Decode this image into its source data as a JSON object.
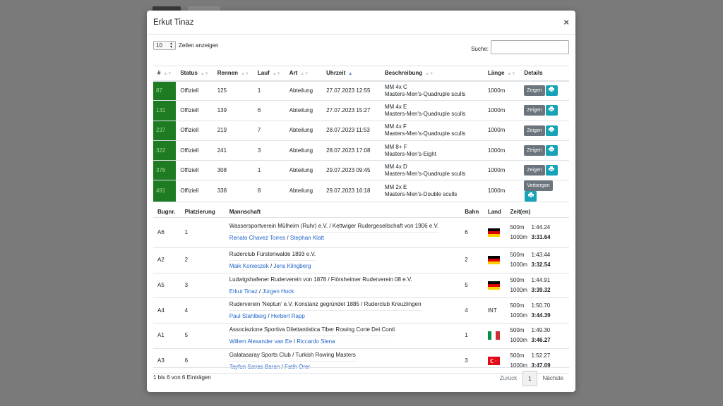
{
  "modal": {
    "title": "Erkut Tinaz"
  },
  "controls": {
    "length_value": "10",
    "length_label": "Zeilen anzeigen",
    "search_label": "Suche:"
  },
  "main_table": {
    "headers": [
      "#",
      "Status",
      "Rennen",
      "Lauf",
      "Art",
      "Uhrzeit",
      "Beschreibung",
      "Länge",
      "Details"
    ],
    "rows": [
      {
        "num": "87",
        "status": "Offiziell",
        "rennen": "125",
        "lauf": "1",
        "art": "Abteilung",
        "uhrzeit": "27.07.2023 12:55",
        "desc1": "MM 4x C",
        "desc2": "Masters-Men's-Quadruple sculls",
        "laenge": "1000m",
        "button": "Zeigen"
      },
      {
        "num": "131",
        "status": "Offiziell",
        "rennen": "139",
        "lauf": "6",
        "art": "Abteilung",
        "uhrzeit": "27.07.2023 15:27",
        "desc1": "MM 4x E",
        "desc2": "Masters-Men's-Quadruple sculls",
        "laenge": "1000m",
        "button": "Zeigen"
      },
      {
        "num": "237",
        "status": "Offiziell",
        "rennen": "219",
        "lauf": "7",
        "art": "Abteilung",
        "uhrzeit": "28.07.2023 11:53",
        "desc1": "MM 4x F",
        "desc2": "Masters-Men's-Quadruple sculls",
        "laenge": "1000m",
        "button": "Zeigen"
      },
      {
        "num": "322",
        "status": "Offiziell",
        "rennen": "241",
        "lauf": "3",
        "art": "Abteilung",
        "uhrzeit": "28.07.2023 17:08",
        "desc1": "MM 8+ F",
        "desc2": "Masters-Men's-Eight",
        "laenge": "1000m",
        "button": "Zeigen"
      },
      {
        "num": "376",
        "status": "Offiziell",
        "rennen": "308",
        "lauf": "1",
        "art": "Abteilung",
        "uhrzeit": "29.07.2023 09:45",
        "desc1": "MM 4x D",
        "desc2": "Masters-Men's-Quadruple sculls",
        "laenge": "1000m",
        "button": "Zeigen"
      },
      {
        "num": "491",
        "status": "Offiziell",
        "rennen": "338",
        "lauf": "8",
        "art": "Abteilung",
        "uhrzeit": "29.07.2023 16:18",
        "desc1": "MM 2x E",
        "desc2": "Masters-Men's-Double sculls",
        "laenge": "1000m",
        "button": "Verbergen"
      }
    ],
    "highlight_color": "#1e7b22"
  },
  "detail_table": {
    "headers": [
      "Bugnr.",
      "Platzierung",
      "Mannschaft",
      "Bahn",
      "Land",
      "Zeit(en)"
    ],
    "rows": [
      {
        "bug": "A6",
        "platz": "1",
        "team": "Wassersportverein Mülheim (Ruhr) e.V. / Kettwiger Rudergesellschaft von 1906 e.V.",
        "rower1": "Renato Chavez Torres",
        "rower2": "Stephan Klatt",
        "bahn": "6",
        "land": "",
        "flag": "germany",
        "d1": "500m",
        "t1": "1:44.24",
        "d2": "1000m",
        "t2": "3:31.64"
      },
      {
        "bug": "A2",
        "platz": "2",
        "team": "Ruderclub Fürstenwalde 1893 e.V.",
        "rower1": "Maik Konieczek",
        "rower2": "Jens Klingberg",
        "bahn": "2",
        "land": "",
        "flag": "germany",
        "d1": "500m",
        "t1": "1:43.44",
        "d2": "1000m",
        "t2": "3:32.54"
      },
      {
        "bug": "A5",
        "platz": "3",
        "team": "Ludwigshafener Ruderverein von 1878 / Flörsheimer Ruderverein 08 e.V.",
        "rower1": "Erkut Tinaz",
        "rower2": "Jürgen Hock",
        "bahn": "5",
        "land": "",
        "flag": "germany",
        "d1": "500m",
        "t1": "1:44.91",
        "d2": "1000m",
        "t2": "3:39.32"
      },
      {
        "bug": "A4",
        "platz": "4",
        "team": "Ruderverein 'Neptun' e.V. Konstanz gegründet 1885 / Ruderclub Kreuzlingen",
        "rower1": "Paul Stahlberg",
        "rower2": "Herbert Rapp",
        "bahn": "4",
        "land": "INT",
        "flag": "",
        "d1": "500m",
        "t1": "1:50.70",
        "d2": "1000m",
        "t2": "3:44.39"
      },
      {
        "bug": "A1",
        "platz": "5",
        "team": "Associazione Sportiva Dilettantistica Tiber Rowing Corte Dei Conti",
        "rower1": "Willem Alexander van Ee",
        "rower2": "Riccardo Siena",
        "bahn": "1",
        "land": "",
        "flag": "italy",
        "d1": "500m",
        "t1": "1:49.30",
        "d2": "1000m",
        "t2": "3:46.27"
      },
      {
        "bug": "A3",
        "platz": "6",
        "team": "Galatasaray Sports Club / Turkish Rowing Masters",
        "rower1": "Tayfun Savas Baran",
        "rower2": "Fatih Örer",
        "bahn": "3",
        "land": "",
        "flag": "turkey",
        "d1": "500m",
        "t1": "1:52.27",
        "d2": "1000m",
        "t2": "3:47.09"
      }
    ]
  },
  "footer": {
    "info": "1 bis 6 von 6 Einträgen",
    "prev": "Zurück",
    "page": "1",
    "next": "Nächste"
  }
}
